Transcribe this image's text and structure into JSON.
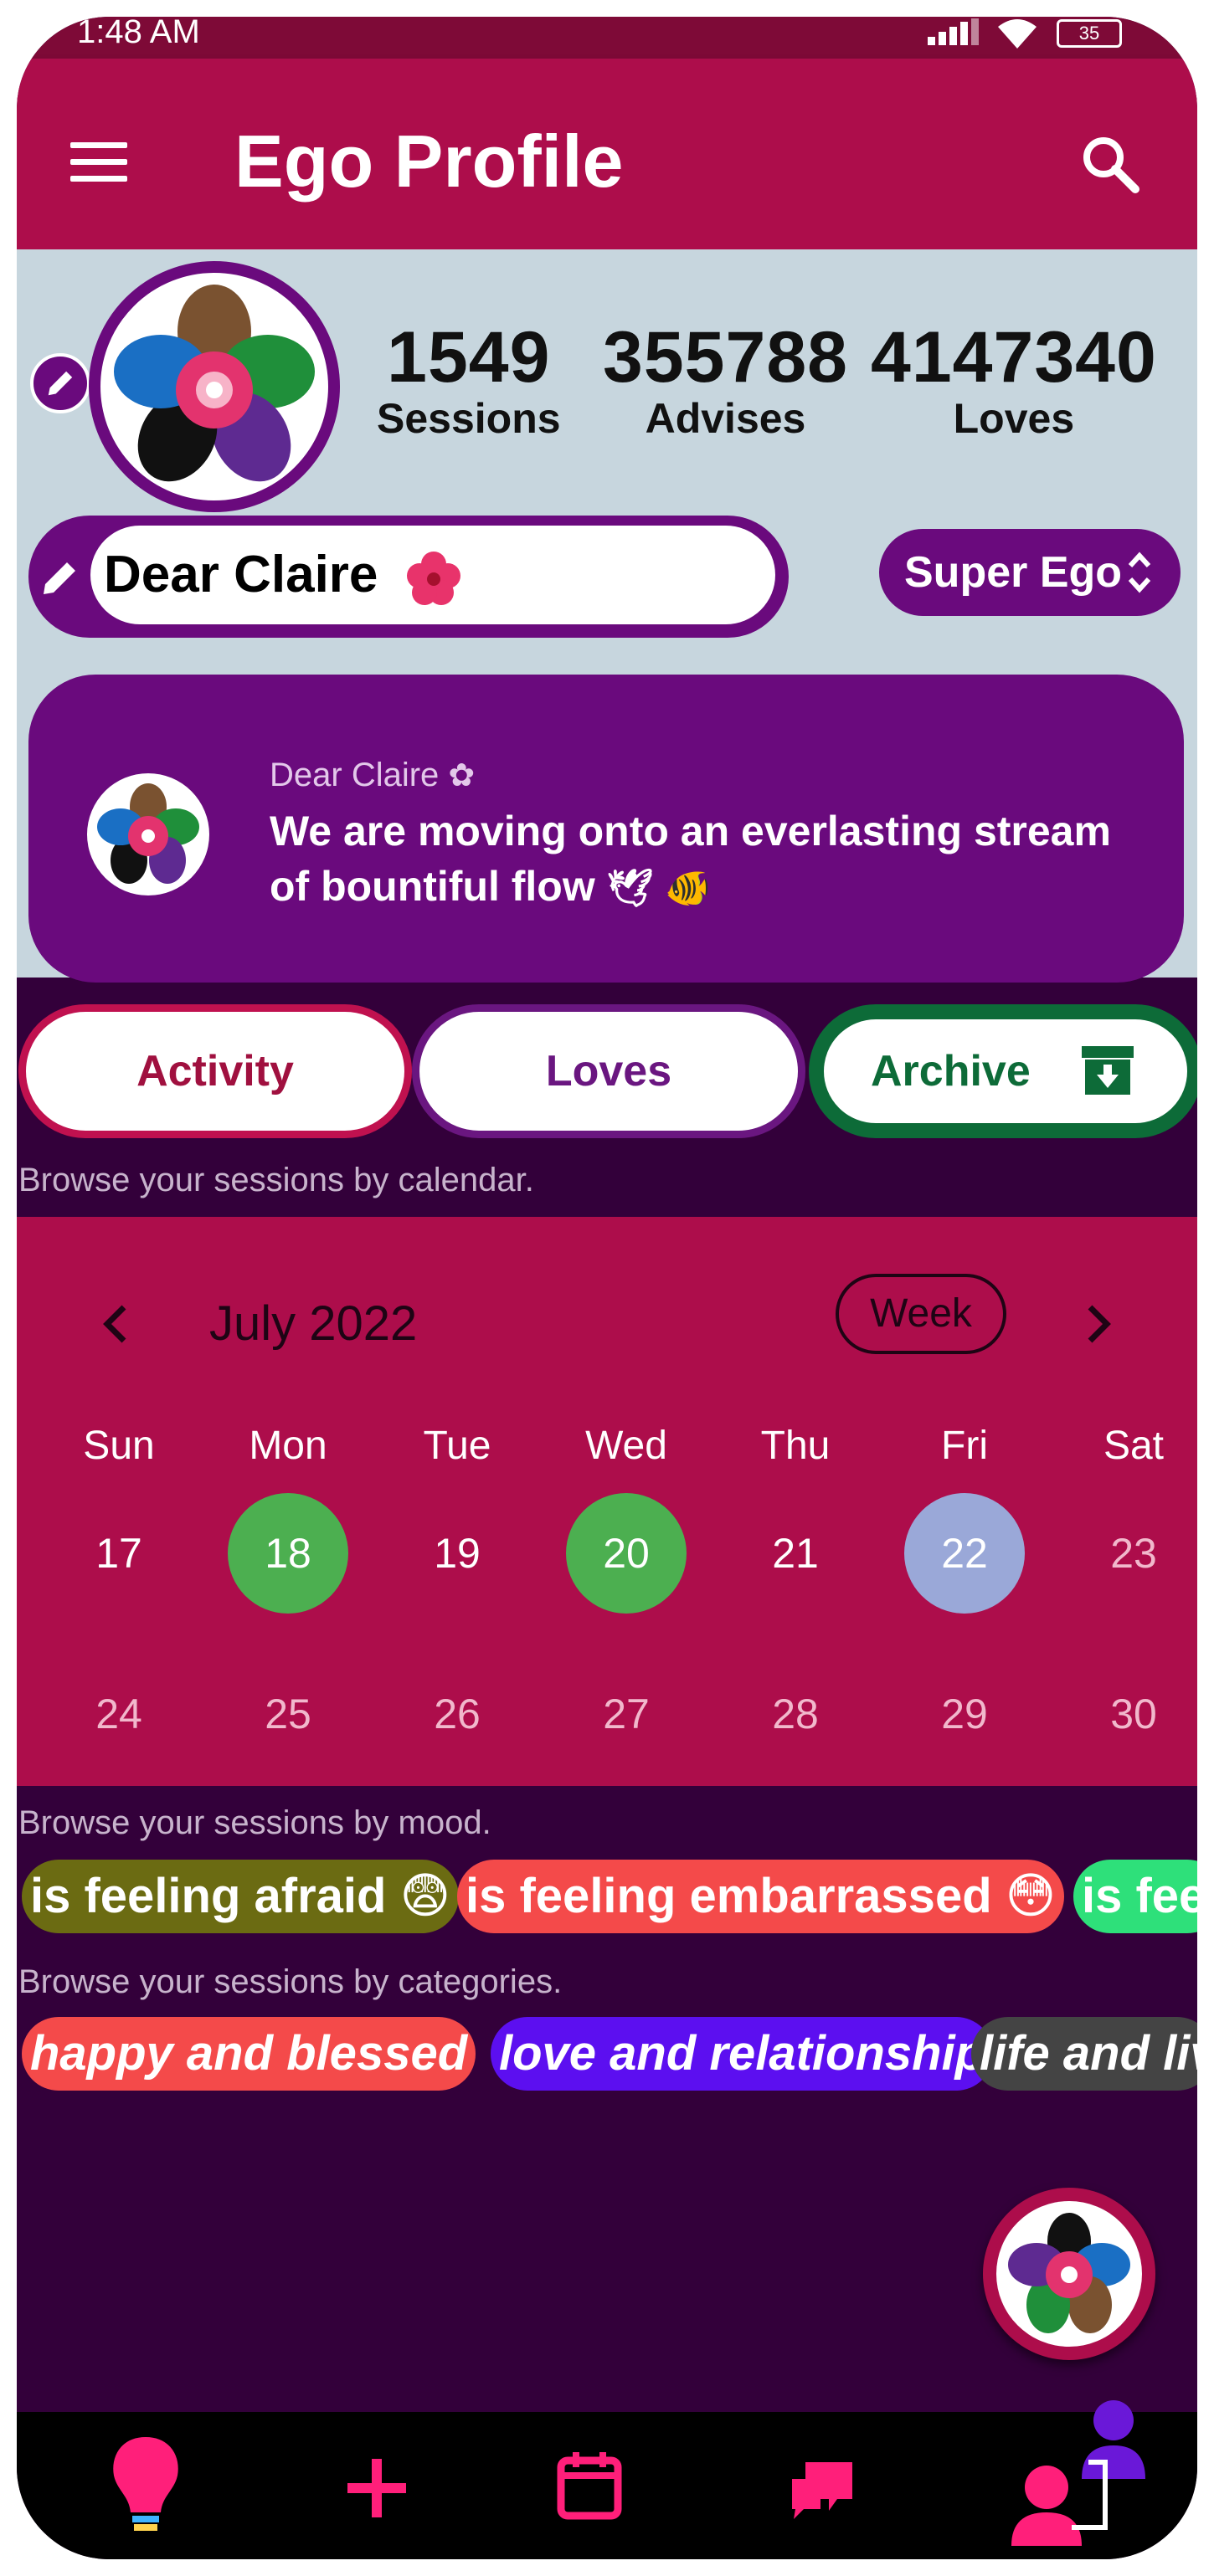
{
  "status_bar": {
    "time": "1:48 AM",
    "battery": "35"
  },
  "app_bar": {
    "title": "Ego Profile",
    "menu_icon": "menu-icon",
    "search_icon": "search-icon"
  },
  "profile": {
    "stats": [
      {
        "value": "1549",
        "label": "Sessions"
      },
      {
        "value": "355788",
        "label": "Advises"
      },
      {
        "value": "4147340",
        "label": "Loves"
      }
    ],
    "name": "Dear Claire",
    "rank": "Super Ego",
    "quote": {
      "author": "Dear Claire",
      "text": "We are moving onto an everlasting stream of bountiful flow"
    }
  },
  "tabs": [
    {
      "label": "Activity"
    },
    {
      "label": "Loves"
    },
    {
      "label": "Archive"
    }
  ],
  "hints": {
    "calendar": "Browse your sessions by calendar.",
    "mood": "Browse your sessions by mood.",
    "categories": "Browse your sessions by categories."
  },
  "calendar": {
    "month": "July 2022",
    "mode": "Week",
    "weekdays": [
      "Sun",
      "Mon",
      "Tue",
      "Wed",
      "Thu",
      "Fri",
      "Sat"
    ],
    "week1": [
      "17",
      "18",
      "19",
      "20",
      "21",
      "22",
      "23"
    ],
    "week2": [
      "24",
      "25",
      "26",
      "27",
      "28",
      "29",
      "30"
    ],
    "session_days": [
      "18",
      "20"
    ],
    "today": "22"
  },
  "moods": [
    {
      "label": "is feeling afraid 😨",
      "color": "#6b6b12"
    },
    {
      "label": "is feeling embarrassed 😳",
      "color": "#f44a4a"
    },
    {
      "label": "is fee",
      "color": "#2ee07a"
    }
  ],
  "categories": [
    {
      "label": "happy and blessed",
      "color": "#f44a4a"
    },
    {
      "label": "love and relationship",
      "color": "#5c0ff0"
    },
    {
      "label": "life and liv",
      "color": "#444444"
    }
  ],
  "colors": {
    "primary": "#ad0d4b",
    "purple": "#6a0a7d",
    "background": "#33003a",
    "green": "#4caf50",
    "archive_green": "#0d6b38"
  },
  "bottom_nav": [
    "lightbulb-icon",
    "plus-icon",
    "calendar-icon",
    "chat-icon",
    "profile-icon"
  ]
}
